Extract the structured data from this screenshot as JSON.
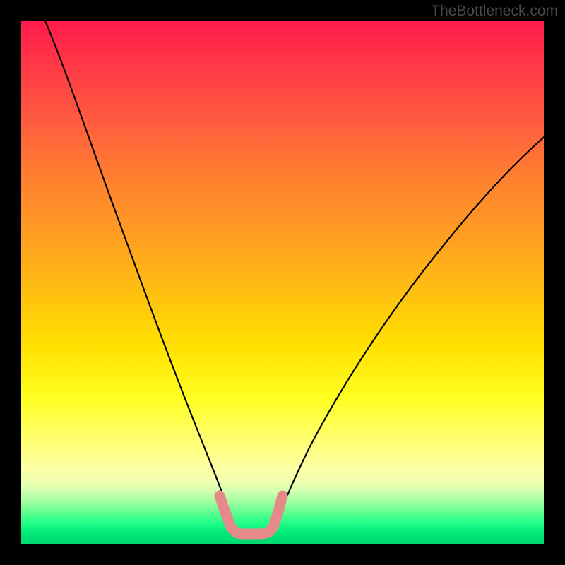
{
  "watermark": "TheBottleneck.com",
  "chart_data": {
    "type": "line",
    "title": "",
    "xlabel": "",
    "ylabel": "",
    "xlim": [
      0,
      100
    ],
    "ylim": [
      0,
      100
    ],
    "note": "V-shaped bottleneck curve on rainbow gradient background. Two black curves descend from top edges toward a flat minimum near the bottom; a salmon/pink highlight marks the optimal zone at the trough.",
    "series": [
      {
        "name": "left-curve",
        "x": [
          4,
          8,
          12,
          16,
          20,
          24,
          28,
          32,
          35,
          37,
          39,
          40
        ],
        "y": [
          100,
          88,
          75,
          63,
          51,
          40,
          30,
          20,
          12,
          7,
          3,
          0
        ]
      },
      {
        "name": "right-curve",
        "x": [
          48,
          50,
          53,
          58,
          64,
          70,
          76,
          82,
          88,
          94,
          100
        ],
        "y": [
          0,
          3,
          8,
          15,
          24,
          33,
          42,
          50,
          57,
          63,
          68
        ]
      },
      {
        "name": "optimal-highlight",
        "x": [
          37,
          38,
          40,
          44,
          47,
          48,
          49
        ],
        "y": [
          7,
          3,
          0,
          0,
          0,
          3,
          7
        ]
      }
    ],
    "colors": {
      "curve": "#000000",
      "highlight": "#e58a8a",
      "gradient_top": "#ff1a4d",
      "gradient_mid": "#ffe000",
      "gradient_bottom": "#00d870"
    }
  }
}
